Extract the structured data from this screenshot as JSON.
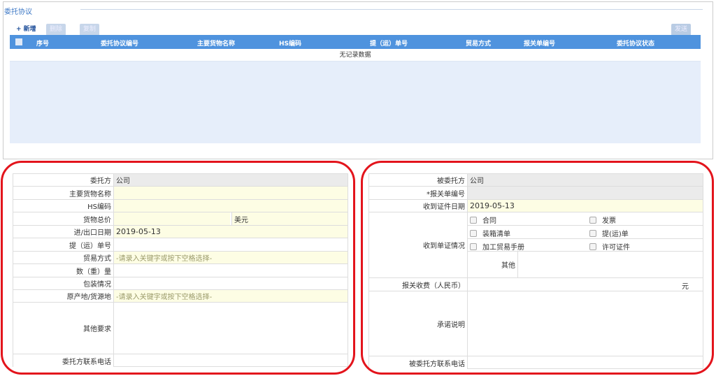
{
  "panel": {
    "title": "委托协议"
  },
  "toolbar": {
    "add": "+ 新增",
    "delete": "删除",
    "copy": "复制",
    "send": "发送"
  },
  "grid": {
    "columns": [
      "序号",
      "委托协议编号",
      "主要货物名称",
      "HS编码",
      "提（运）单号",
      "贸易方式",
      "报关单编号",
      "委托协议状态"
    ],
    "empty_text": "无记录数据"
  },
  "left_form": {
    "consignor_label": "委托方",
    "consignor_value": "公司",
    "goods_name_label": "主要货物名称",
    "hs_label": "HS编码",
    "total_price_label": "货物总价",
    "currency": "美元",
    "date_label": "进/出口日期",
    "date_value": "2019-05-13",
    "bl_label": "提（运）单号",
    "trade_label": "贸易方式",
    "trade_placeholder": "-请录入关键字或按下空格选择-",
    "qty_label": "数（重）量",
    "pack_label": "包装情况",
    "origin_label": "原产地/货源地",
    "origin_placeholder": "-请录入关键字或按下空格选择-",
    "other_label": "其他要求",
    "phone_label": "委托方联系电话"
  },
  "right_form": {
    "consignee_label": "被委托方",
    "consignee_value": "公司",
    "decl_no_label": "*报关单编号",
    "recv_date_label": "收到证件日期",
    "recv_date_value": "2019-05-13",
    "docs_label": "收到单证情况",
    "docs": [
      {
        "label": "合同",
        "checked": false
      },
      {
        "label": "发票",
        "checked": false
      },
      {
        "label": "装箱清单",
        "checked": false
      },
      {
        "label": "提(运)单",
        "checked": false
      },
      {
        "label": "加工贸易手册",
        "checked": false
      },
      {
        "label": "许可证件",
        "checked": false
      }
    ],
    "other_label": "其他",
    "fee_label": "报关收费（人民币）",
    "fee_unit": "元",
    "promise_label": "承诺说明",
    "phone_label": "被委托方联系电话"
  }
}
